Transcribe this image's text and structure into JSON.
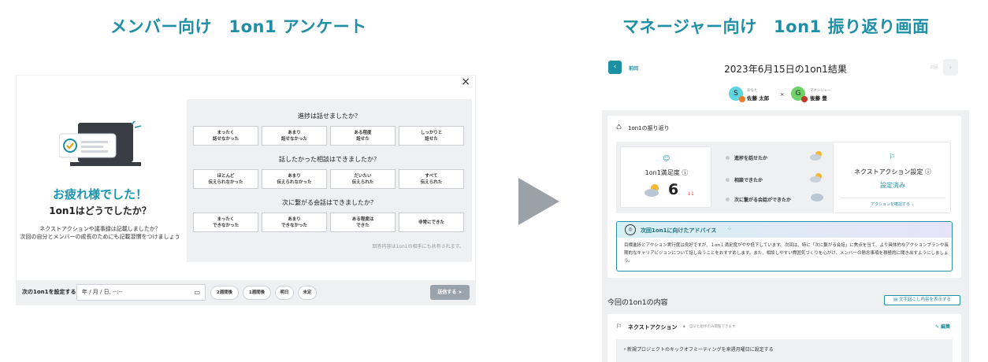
{
  "headings": {
    "left": "メンバー向け　1on1 アンケート",
    "right": "マネージャー向け　1on1 振り返り画面"
  },
  "survey": {
    "close_icon": "×",
    "thanks_title": "お疲れ様でした！",
    "thanks_subtitle": "1on1はどうでしたか？",
    "thanks_line1": "ネクストアクションや議事録は記載しましたか？",
    "thanks_line2": "次回の自分とメンバーの成長のためにも記載習慣をつけましょう",
    "questions": [
      {
        "title": "進捗は話せましたか？",
        "options": [
          "まったく\n話せなかった",
          "あまり\n話せなかった",
          "ある程度\n話せた",
          "しっかりと\n話せた"
        ]
      },
      {
        "title": "話したかった相談はできましたか？",
        "options": [
          "ほとんど\n伝えられなかった",
          "あまり\n伝えられなかった",
          "だいたい\n伝えられた",
          "すべて\n伝えられた"
        ]
      },
      {
        "title": "次に繋がる会話はできましたか？",
        "options": [
          "まったく\nできなかった",
          "あまり\nできなかった",
          "ある程度は\nできた",
          "非常にできた"
        ]
      }
    ],
    "share_note": "回答内容は1on1の相手にも共有されます。",
    "next_label": "次の1on1を設定する",
    "date_placeholder": "年 / 月 / 日, --:--",
    "calendar_icon": "calendar-icon",
    "quick_buttons": [
      "2週間後",
      "1週間後",
      "明日",
      "未定"
    ],
    "send_label": "送信する"
  },
  "review": {
    "back_label": "前回",
    "title": "2023年6月15日の1on1結果",
    "next_label": "次回",
    "you": {
      "initial": "S",
      "role": "あなた",
      "name": "佐藤 太郎"
    },
    "partner": {
      "initial": "G",
      "role": "マネージャー",
      "name": "後藤 豊"
    },
    "times": "×",
    "section1_title": "1on1の振り返り",
    "satisfaction_label": "1on1満足度 ⓘ",
    "satisfaction_value": "6",
    "satisfaction_delta": "↓1",
    "metrics": [
      "進捗を話せたか",
      "相談できたか",
      "次に繋がる会話ができたか"
    ],
    "next_action_title": "ネクストアクション設定 ⓘ",
    "next_action_status": "設定済み",
    "next_action_link": "アクションを確認する ⌄",
    "advice_title": "次回1on1に向けたアドバイス",
    "advice_text": "目標進捗とアクション実行度は良好ですが、１on１満足度がやや低下しています。次回は、特に「次に繋がる会話」に焦点を当て、より具体的なアクションプランや長期的なキャリアビジョンについて話し合うことをおすすめします。また、相談しやすい雰囲気づくりを心がけ、メンバーの懸念事項を積極的に聞き出すようにしましょう。",
    "section2_title": "今回の1on1の内容",
    "transcript_button": "文字起こし内容を表示する",
    "na_section_title": "ネクストアクション",
    "na_section_note": "自分と相手のみ閲覧できます",
    "edit_label": "編集",
    "na_item": "・新規プロジェクトのキックオフミーティングを来週月曜日に設定する"
  },
  "colors": {
    "accent": "#1f8fa6",
    "avatar_you": "#5fd3e0",
    "avatar_partner": "#6fd36a"
  }
}
